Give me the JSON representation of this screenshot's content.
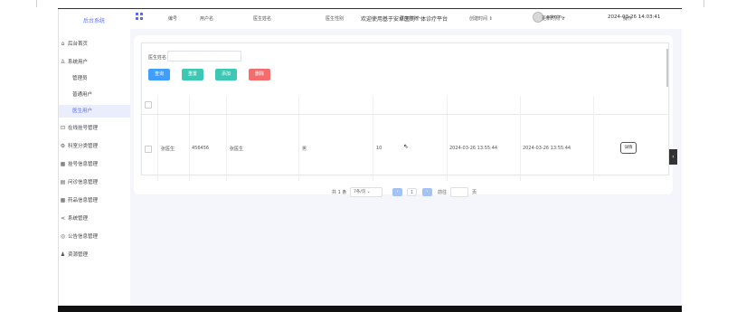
{
  "sidebar": {
    "brand": "后台系统",
    "items": [
      {
        "icon": "home-icon",
        "glyph": "⌂",
        "label": "后台首页"
      },
      {
        "icon": "user-icon",
        "glyph": "♙",
        "label": "系统用户"
      },
      {
        "label": "管理员"
      },
      {
        "label": "普通用户"
      },
      {
        "label": "医生用户"
      },
      {
        "icon": "clipboard-icon",
        "glyph": "⊡",
        "label": "在线挂号管理"
      },
      {
        "icon": "gear-icon",
        "glyph": "⚙",
        "label": "科室分类管理"
      },
      {
        "icon": "grid-icon",
        "glyph": "▦",
        "label": "挂号信息管理"
      },
      {
        "icon": "building-icon",
        "glyph": "▤",
        "label": "问诊信息管理"
      },
      {
        "icon": "table-icon",
        "glyph": "▦",
        "label": "药品信息管理"
      },
      {
        "icon": "share-icon",
        "glyph": "⋖",
        "label": "系统管理"
      },
      {
        "icon": "chat-icon",
        "glyph": "◎",
        "label": "公告信息管理"
      },
      {
        "icon": "group-icon",
        "glyph": "♟",
        "label": "资源管理"
      }
    ]
  },
  "header": {
    "welcome": "欢迎使用基于安卓医的个体诊疗平台",
    "user": "admin⌄",
    "datetime": "2024-03-26 14:03:41"
  },
  "search": {
    "label": "医生姓名",
    "value": ""
  },
  "buttons": {
    "query": "查询",
    "reset": "重置",
    "add": "添加",
    "delete": "删除",
    "colors": {
      "query": "#409eff",
      "reset": "#3cc8b4",
      "add": "#3cc8b4",
      "delete": "#f56c6c"
    }
  },
  "table": {
    "headers": [
      "编号",
      "用户名",
      "医生姓名",
      "医生性别",
      "医生简称",
      "创建时间 ⇕",
      "更新时间 ⇕",
      "操作"
    ],
    "rows": [
      {
        "id": "张医生",
        "username": "456456",
        "name": "张医生",
        "gender": "男",
        "short": "10",
        "created": "2024-03-26 13:55:44",
        "updated": "2024-03-26 13:55:44",
        "action": "详情"
      }
    ]
  },
  "pagination": {
    "total": "共 1 条",
    "page_size": "7条/页  ⌄",
    "prev": "‹",
    "current": "1",
    "next": "›",
    "goto_label": "前往",
    "goto_value": "",
    "page_suffix": "页"
  },
  "right_tab": "‹"
}
